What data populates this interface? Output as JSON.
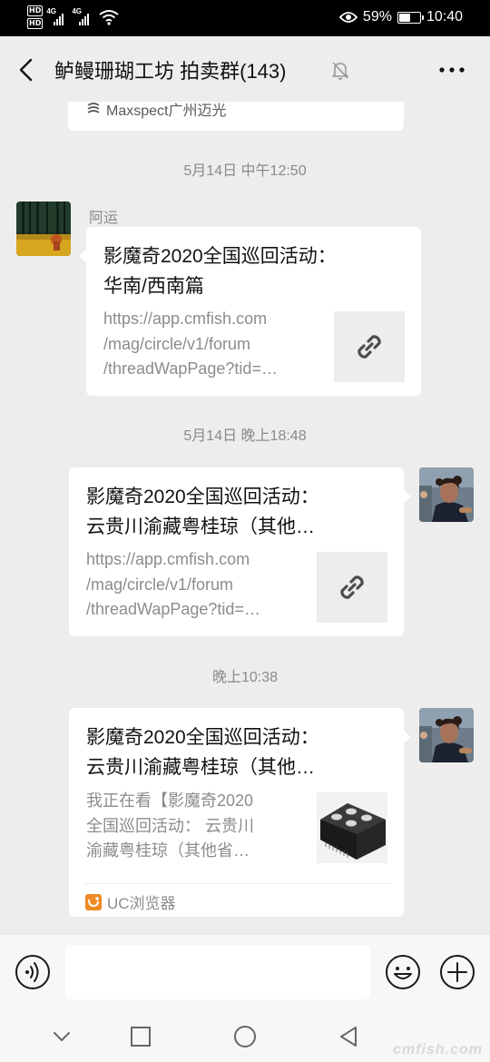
{
  "status_bar": {
    "hd_labels": [
      "HD",
      "HD"
    ],
    "net_labels": [
      "4G",
      "4G"
    ],
    "battery_percent": "59%",
    "battery_level": 0.59,
    "time": "10:40"
  },
  "header": {
    "title": "鲈鳗珊瑚工坊 拍卖群(143)"
  },
  "chat": {
    "partial_card": {
      "source_name": "Maxspect广州迈光"
    },
    "timestamps": [
      "5月14日 中午12:50",
      "5月14日 晚上18:48",
      "晚上10:38"
    ],
    "messages": [
      {
        "sender": "阿运",
        "title_lines": [
          "影魔奇2020全国巡回活动：",
          "华南/西南篇"
        ],
        "desc_lines": [
          "https://app.cmfish.com",
          "/mag/circle/v1/forum",
          "/threadWapPage?tid=…"
        ]
      },
      {
        "title_lines": [
          "影魔奇2020全国巡回活动：",
          "云贵川渝藏粤桂琼（其他…"
        ],
        "desc_lines": [
          "https://app.cmfish.com",
          "/mag/circle/v1/forum",
          "/threadWapPage?tid=…"
        ]
      },
      {
        "title_lines": [
          "影魔奇2020全国巡回活动：",
          "云贵川渝藏粤桂琼（其他…"
        ],
        "desc_lines": [
          "我正在看【影魔奇2020",
          "全国巡回活动： 云贵川",
          "渝藏粤桂琼（其他省…"
        ],
        "source_app": "UC浏览器"
      }
    ]
  },
  "input_bar": {
    "placeholder": ""
  },
  "watermark": "cmfish.com",
  "colors": {
    "chat_background": "#ededed",
    "bubble": "#ffffff",
    "status_bar": "#000000",
    "uc_orange": "#f08a24"
  }
}
